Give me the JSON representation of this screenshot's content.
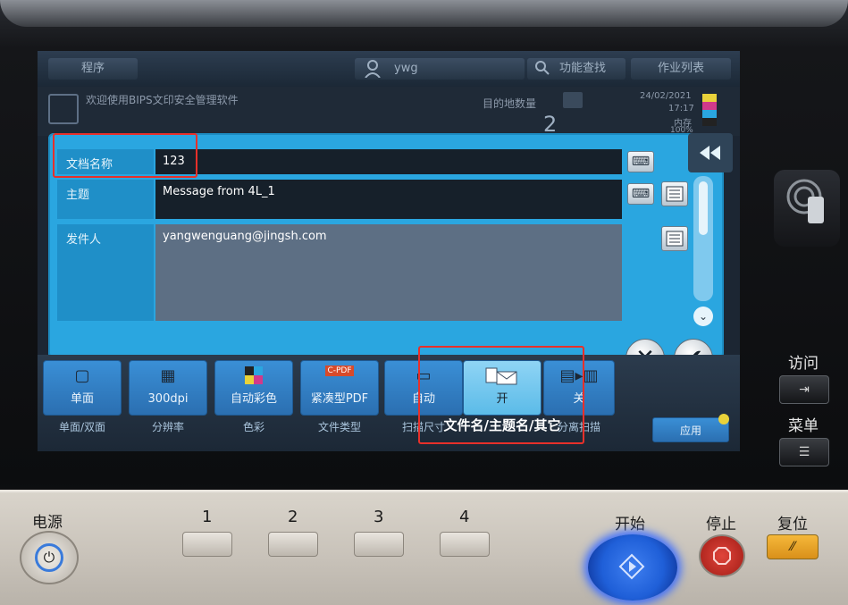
{
  "topbar": {
    "program_label": "程序",
    "user_label": "ywg",
    "search_label": "功能查找",
    "job_list_label": "作业列表"
  },
  "status": {
    "welcome_text": "欢迎使用BIPS文印安全管理软件",
    "destination_count_label": "目的地数量",
    "destination_count": "2",
    "date": "24/02/2021",
    "time": "17:17",
    "memory_label": "内存",
    "memory_value": "100%",
    "toner_letters": [
      "Y",
      "M",
      "C",
      "K"
    ]
  },
  "dialog": {
    "fields": [
      {
        "label": "文档名称",
        "value": "123"
      },
      {
        "label": "主题",
        "value": "Message from 4L_1"
      },
      {
        "label": "发件人",
        "value": "yangwenguang@jingsh.com"
      }
    ],
    "back_icon": "double-arrow-left-icon",
    "cancel_icon": "close-icon",
    "ok_icon": "check-icon"
  },
  "tiles": [
    {
      "value": "单面",
      "caption": "单面/双面",
      "icon": "simplex-icon"
    },
    {
      "value": "300dpi",
      "caption": "分辨率",
      "icon": "resolution-icon"
    },
    {
      "value": "自动彩色",
      "caption": "色彩",
      "icon": "color-icon"
    },
    {
      "value": "紧凑型PDF",
      "caption": "文件类型",
      "icon": "pdf-icon",
      "icon_text": "C-PDF"
    },
    {
      "value": "自动",
      "caption": "扫描尺寸",
      "icon": "scan-size-icon"
    },
    {
      "value": "开",
      "caption": "文件名/主题名/其它",
      "icon": "mail-doc-icon"
    },
    {
      "value": "关",
      "caption": "分离扫描",
      "icon": "separate-scan-icon"
    }
  ],
  "apply_label": "应用",
  "hardware": {
    "power_label": "电源",
    "numbers": [
      "1",
      "2",
      "3",
      "4"
    ],
    "start_label": "开始",
    "stop_label": "停止",
    "reset_label": "复位",
    "access_label": "访问",
    "menu_label": "菜单"
  },
  "colors": {
    "dialog_blue": "#2aa6e0",
    "highlight_red": "#e8302a",
    "start_blue": "#1f5fd8"
  }
}
